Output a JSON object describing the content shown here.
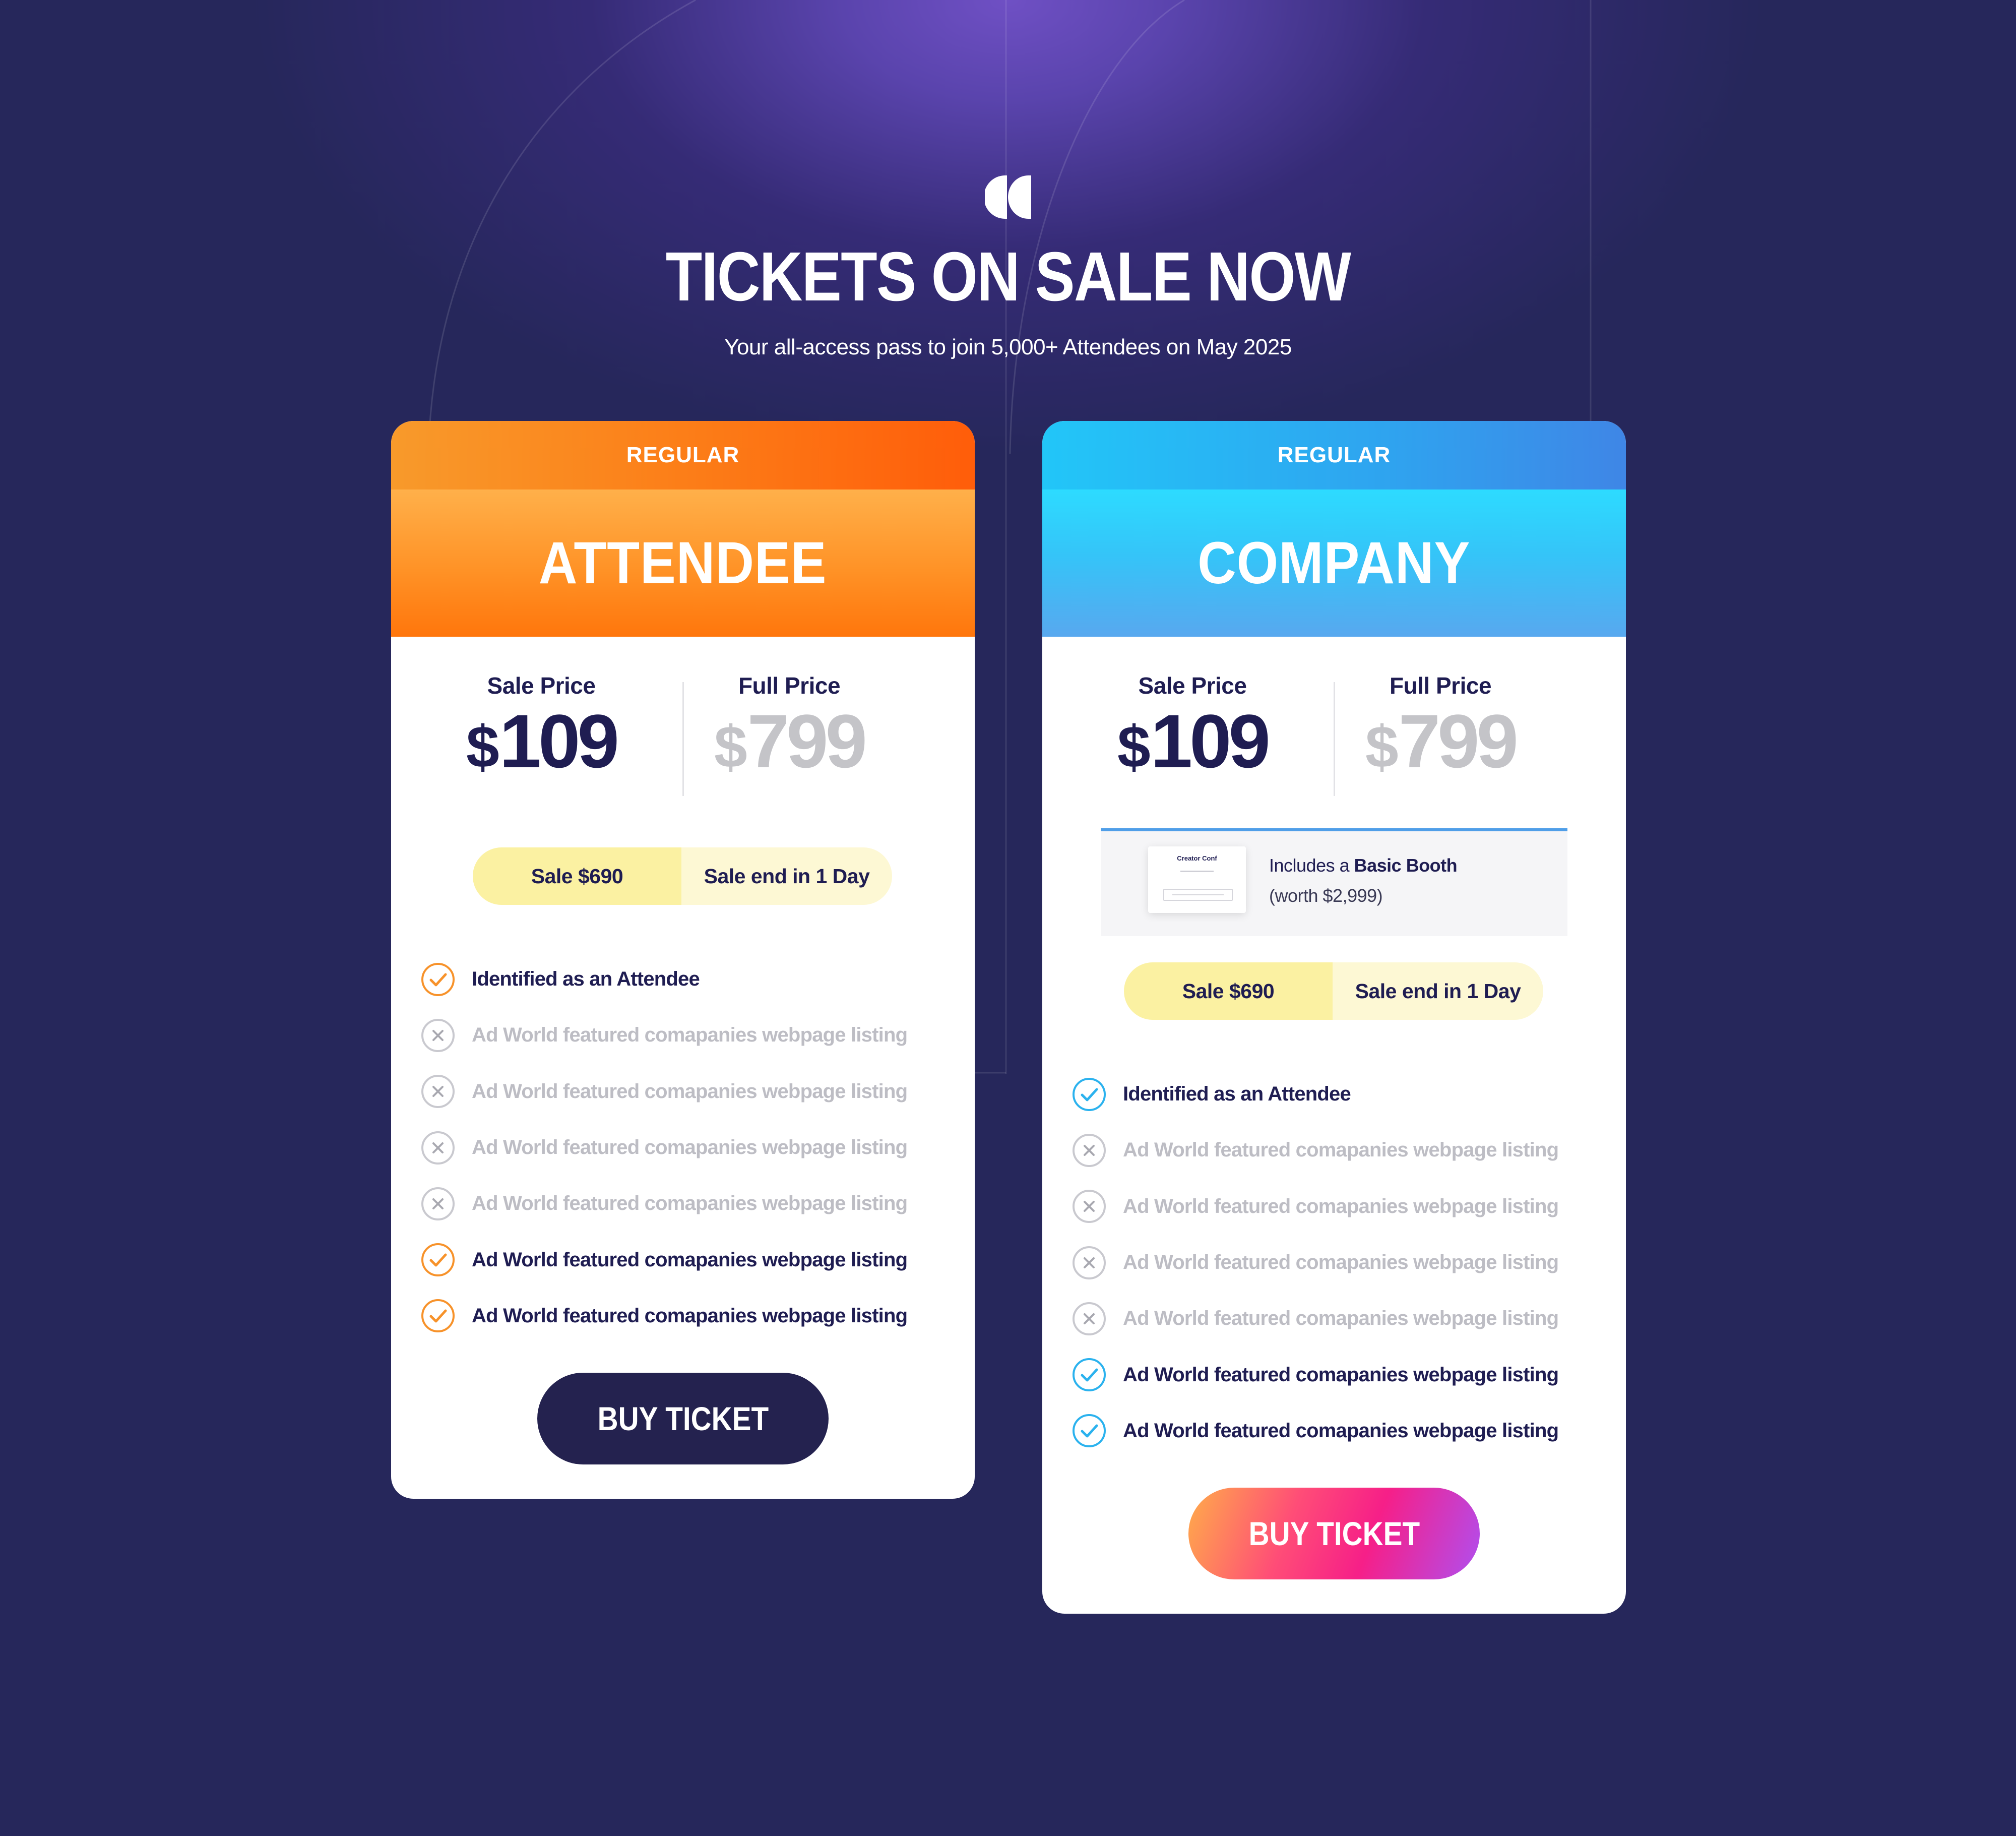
{
  "header": {
    "title": "TICKETS ON SALE NOW",
    "subtitle": "Your all-access pass to join 5,000+ Attendees on May 2025"
  },
  "cards": [
    {
      "tier": "REGULAR",
      "name": "ATTENDEE",
      "sale_label": "Sale Price",
      "sale_currency": "$",
      "sale_amount": "109",
      "full_label": "Full Price",
      "full_currency": "$",
      "full_amount": "799",
      "pill_sale": "Sale $690",
      "pill_end": "Sale end in 1 Day",
      "accent": "#f7922a",
      "features": [
        {
          "text": "Identified as an Attendee",
          "included": true
        },
        {
          "text": "Ad World featured comapanies webpage listing",
          "included": false
        },
        {
          "text": "Ad World featured comapanies webpage listing",
          "included": false
        },
        {
          "text": "Ad World featured comapanies webpage listing",
          "included": false
        },
        {
          "text": "Ad World featured comapanies webpage listing",
          "included": false
        },
        {
          "text": "Ad World featured comapanies webpage listing",
          "included": true
        },
        {
          "text": "Ad World featured comapanies webpage listing",
          "included": true
        }
      ],
      "button": "BUY TICKET"
    },
    {
      "tier": "REGULAR",
      "name": "COMPANY",
      "sale_label": "Sale Price",
      "sale_currency": "$",
      "sale_amount": "109",
      "full_label": "Full Price",
      "full_currency": "$",
      "full_amount": "799",
      "booth": {
        "thumb_title": "Creator Conf",
        "prefix": "Includes a ",
        "bold": "Basic Booth",
        "worth": "(worth $2,999)"
      },
      "pill_sale": "Sale $690",
      "pill_end": "Sale end in 1 Day",
      "accent": "#2bb2ee",
      "features": [
        {
          "text": "Identified as an Attendee",
          "included": true
        },
        {
          "text": "Ad World featured comapanies webpage listing",
          "included": false
        },
        {
          "text": "Ad World featured comapanies webpage listing",
          "included": false
        },
        {
          "text": "Ad World featured comapanies webpage listing",
          "included": false
        },
        {
          "text": "Ad World featured comapanies webpage listing",
          "included": false
        },
        {
          "text": "Ad World featured comapanies webpage listing",
          "included": true
        },
        {
          "text": "Ad World featured comapanies webpage listing",
          "included": true
        }
      ],
      "button": "BUY TICKET"
    }
  ],
  "icons": {
    "logo": "quote-icon",
    "included": "check-circle-icon",
    "excluded": "x-circle-icon"
  },
  "colors": {
    "background": "#26275b",
    "text_dark": "#1f1d52",
    "muted": "#bdbdc4"
  }
}
